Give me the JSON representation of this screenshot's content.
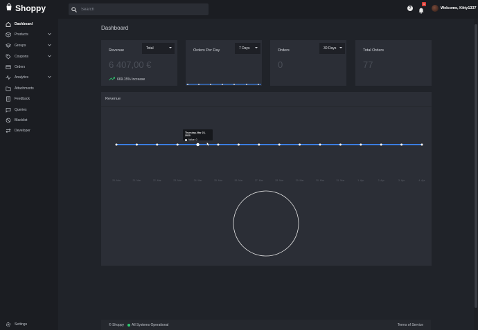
{
  "app": {
    "brand": "Shoppy"
  },
  "search": {
    "placeholder": "Search"
  },
  "header": {
    "notification_count": "1",
    "user_label": "Welcome, Kitty1337"
  },
  "sidebar": {
    "items": [
      {
        "label": "Dashboard",
        "icon": "home-icon",
        "active": true
      },
      {
        "label": "Products",
        "icon": "box-icon",
        "expandable": true
      },
      {
        "label": "Groups",
        "icon": "layers-icon",
        "expandable": true
      },
      {
        "label": "Coupons",
        "icon": "tag-icon",
        "expandable": true
      },
      {
        "label": "Orders",
        "icon": "card-icon"
      },
      {
        "label": "Analytics",
        "icon": "analytics-icon",
        "expandable": true
      },
      {
        "label": "Attachments",
        "icon": "folder-icon"
      },
      {
        "label": "Feedback",
        "icon": "document-icon"
      },
      {
        "label": "Queries",
        "icon": "chat-icon"
      },
      {
        "label": "Blacklist",
        "icon": "block-icon"
      },
      {
        "label": "Developer",
        "icon": "arrows-icon"
      }
    ],
    "settings_label": "Settings"
  },
  "page": {
    "title": "Dashboard"
  },
  "cards": {
    "revenue": {
      "title": "Revenue",
      "select": "Total",
      "value": "6 407,00 €",
      "increase": "669.15% Increase"
    },
    "orders_per_day": {
      "title": "Orders Per Day",
      "select": "7 Days"
    },
    "orders": {
      "title": "Orders",
      "select": "30 Days",
      "value": "0"
    },
    "total_orders": {
      "title": "Total Orders",
      "value": "77"
    }
  },
  "revenue_panel": {
    "title": "Revenue"
  },
  "tooltip": {
    "date": "Thursday, Mar 23, 2020",
    "value_label": "Value: 0"
  },
  "chart_data": {
    "type": "line",
    "categories": [
      "20. Mar",
      "21. Mar",
      "22. Mar",
      "23. Mar",
      "24. Mar",
      "25. Mar",
      "26. Mar",
      "27. Mar",
      "28. Mar",
      "29. Mar",
      "30. Mar",
      "31. Mar",
      "1. Apr",
      "2. Apr",
      "3. Apr",
      "4. Apr"
    ],
    "values": [
      0,
      0,
      0,
      0,
      0,
      0,
      0,
      0,
      0,
      0,
      0,
      0,
      0,
      0,
      0,
      0
    ],
    "grid": false,
    "colors": {
      "line": "#3a7de0",
      "point": "#ffffff"
    }
  },
  "footer": {
    "copyright": "© Shoppy",
    "status": "All Systems Operational",
    "terms": "Terms of Service"
  },
  "colors": {
    "accent": "#3a7de0",
    "status_green": "#2ecc71",
    "badge_red": "#d9413a"
  }
}
